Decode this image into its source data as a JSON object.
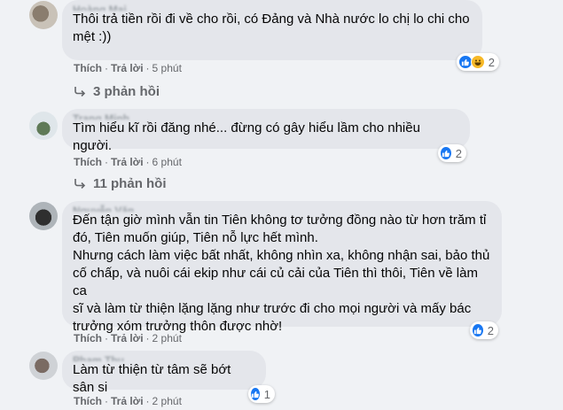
{
  "actions": {
    "like": "Thích",
    "reply": "Trả lời",
    "separator": "·"
  },
  "comments": [
    {
      "author": "Hoàng Mai",
      "text": "Thôi trả tiền rồi đi về cho rồi, có Đảng và Nhà nước lo chị lo chi cho\nmệt :))",
      "time": "5 phút",
      "reaction_count": "2",
      "reactions": [
        "like-icon",
        "haha-icon"
      ],
      "replies_label": "3 phản hồi"
    },
    {
      "author": "Trang Minh",
      "text": "Tìm hiểu kĩ rồi đăng nhé... đừng có gây hiểu lầm cho nhiều người.",
      "time": "6 phút",
      "reaction_count": "2",
      "reactions": [
        "like-icon"
      ],
      "replies_label": "11 phản hồi"
    },
    {
      "author": "Nguyễn Văn",
      "text": "Đến tận giờ mình vẫn tin Tiên không tơ tưởng đồng nào từ hơn trăm tỉ\nđó, Tiên muốn giúp, Tiên nỗ lực hết mình.\nNhưng cách làm việc bất nhất, không nhìn xa, không nhận sai, bảo thủ\ncố chấp, và nuôi cái ekip như cái củ cải của Tiên thì thôi, Tiên về làm ca\nsĩ và làm từ thiện lặng lặng như trước đi cho mọi người và mấy bác\ntrưởng xóm trưởng thôn được nhờ!",
      "time": "2 phút",
      "reaction_count": "2",
      "reactions": [
        "like-icon"
      ]
    },
    {
      "author": "Phạm Thu",
      "text": "Làm từ thiện từ tâm sẽ bớt sân si",
      "time": "2 phút",
      "reaction_count": "1",
      "reactions": [
        "like-icon"
      ]
    }
  ]
}
